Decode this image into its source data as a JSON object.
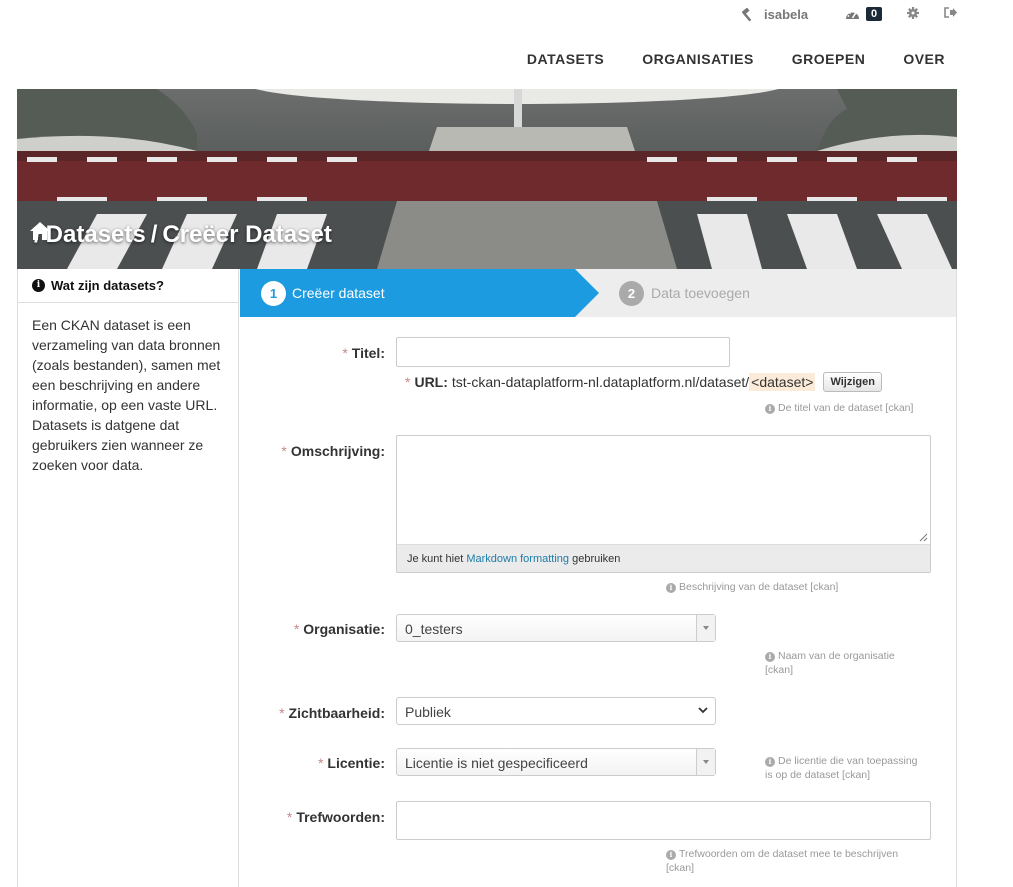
{
  "account": {
    "username": "isabela",
    "dashboard_count": "0"
  },
  "nav": {
    "datasets": "DATASETS",
    "organisaties": "ORGANISATIES",
    "groepen": "GROEPEN",
    "over": "OVER"
  },
  "breadcrumb": {
    "sep": "/",
    "datasets": "Datasets",
    "current": "Creëer Dataset"
  },
  "sidebar": {
    "title": "Wat zijn datasets?",
    "body": "Een CKAN dataset is een verzameling van data bronnen (zoals bestanden), samen met een beschrijving en andere informatie, op een vaste URL. Datasets is datgene dat gebruikers zien wanneer ze zoeken voor data."
  },
  "stages": {
    "stage1_num": "1",
    "stage1_label": "Creëer dataset",
    "stage2_num": "2",
    "stage2_label": "Data toevoegen"
  },
  "form": {
    "required_mark": "*",
    "title_label": "Titel:",
    "title_value": "",
    "url_label": "URL:",
    "url_base": "tst-ckan-dataplatform-nl.dataplatform.nl/dataset/",
    "url_slug": "<dataset>",
    "url_edit_button": "Wijzigen",
    "title_help": "De titel van de dataset [ckan]",
    "description_label": "Omschrijving:",
    "description_value": "",
    "markdown_prefix": "Je kunt hiet",
    "markdown_link": "Markdown formatting",
    "markdown_suffix": "gebruiken",
    "description_help": "Beschrijving van de dataset [ckan]",
    "organisation_label": "Organisatie:",
    "organisation_value": "0_testers",
    "organisation_help_1": "Naam van de organisatie",
    "organisation_help_2": "[ckan]",
    "visibility_label": "Zichtbaarheid:",
    "visibility_value": "Publiek",
    "license_label": "Licentie:",
    "license_value": "Licentie is niet gespecificeerd",
    "license_help_1": "De licentie die van toepassing",
    "license_help_2": "is op de dataset [ckan]",
    "tags_label": "Trefwoorden:",
    "tags_value": "",
    "tags_help_1": "Trefwoorden om de dataset mee te beschrijven",
    "tags_help_2": "[ckan]"
  },
  "colors": {
    "accent": "#1d9be0",
    "stage_inactive": "#ededed",
    "required": "#c6898b",
    "link": "#1d7ca8"
  },
  "icons": {
    "user": "hammer-icon",
    "dashboard": "dashboard-icon",
    "settings": "gear-icon",
    "logout": "logout-icon",
    "home": "home-icon",
    "info": "info-icon"
  }
}
